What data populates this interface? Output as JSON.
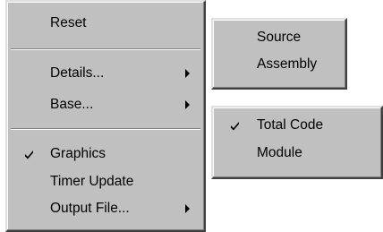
{
  "main_menu": {
    "items": [
      {
        "label": "Reset"
      },
      {
        "label": "Details..."
      },
      {
        "label": "Base..."
      },
      {
        "label": "Graphics",
        "checked": true
      },
      {
        "label": "Timer Update"
      },
      {
        "label": "Output File..."
      }
    ]
  },
  "details_submenu": {
    "items": [
      {
        "label": "Source"
      },
      {
        "label": "Assembly"
      }
    ]
  },
  "base_submenu": {
    "items": [
      {
        "label": "Total Code",
        "checked": true
      },
      {
        "label": "Module"
      }
    ]
  },
  "icons": {
    "check": "check-mark-icon",
    "submenu_arrow": "submenu-arrow-icon"
  },
  "colors": {
    "menu_face": "#c0c0c0",
    "highlight": "#ffffff",
    "shadow": "#808080",
    "dark_shadow": "#404040",
    "text": "#000000"
  }
}
